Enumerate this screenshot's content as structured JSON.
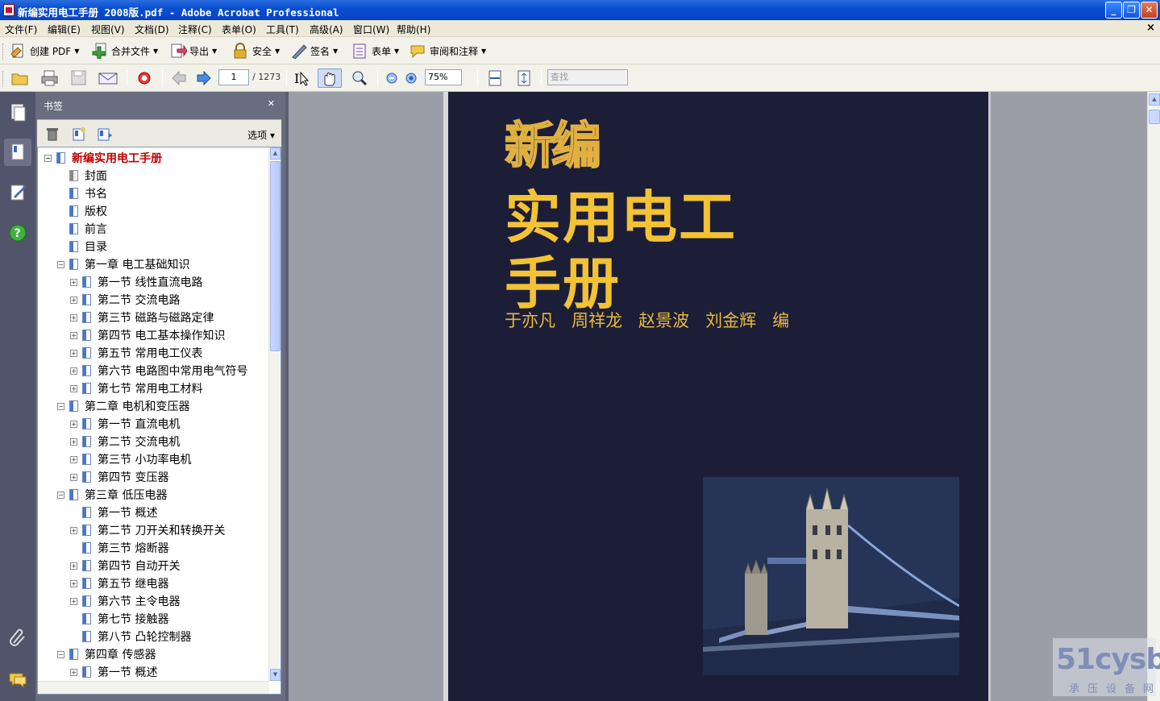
{
  "window": {
    "title": "新编实用电工手册 2008版.pdf - Adobe Acrobat Professional"
  },
  "menu": [
    "文件(F)",
    "编辑(E)",
    "视图(V)",
    "文档(D)",
    "注释(C)",
    "表单(O)",
    "工具(T)",
    "高级(A)",
    "窗口(W)",
    "帮助(H)"
  ],
  "toolbar1": {
    "create_pdf": "创建 PDF",
    "combine": "合并文件",
    "export": "导出",
    "secure": "安全",
    "sign": "签名",
    "forms": "表单",
    "review": "审阅和注释"
  },
  "toolbar2": {
    "page_current": "1",
    "page_total": "/ 1273",
    "zoom": "75%",
    "find_placeholder": "查找"
  },
  "bookmarks": {
    "title": "书签",
    "options": "选项",
    "items": [
      {
        "label": "新编实用电工手册",
        "level": 0,
        "exp": "⊟",
        "root": true
      },
      {
        "label": "封面",
        "level": 1,
        "exp": "",
        "gray": true
      },
      {
        "label": "书名",
        "level": 1,
        "exp": ""
      },
      {
        "label": "版权",
        "level": 1,
        "exp": ""
      },
      {
        "label": "前言",
        "level": 1,
        "exp": ""
      },
      {
        "label": "目录",
        "level": 1,
        "exp": ""
      },
      {
        "label": "第一章  电工基础知识",
        "level": 1,
        "exp": "⊟"
      },
      {
        "label": "第一节  线性直流电路",
        "level": 2,
        "exp": "⊞"
      },
      {
        "label": "第二节  交流电路",
        "level": 2,
        "exp": "⊞"
      },
      {
        "label": "第三节  磁路与磁路定律",
        "level": 2,
        "exp": "⊞"
      },
      {
        "label": "第四节  电工基本操作知识",
        "level": 2,
        "exp": "⊞"
      },
      {
        "label": "第五节  常用电工仪表",
        "level": 2,
        "exp": "⊞"
      },
      {
        "label": "第六节  电路图中常用电气符号",
        "level": 2,
        "exp": "⊞"
      },
      {
        "label": "第七节  常用电工材料",
        "level": 2,
        "exp": "⊞"
      },
      {
        "label": "第二章  电机和变压器",
        "level": 1,
        "exp": "⊟"
      },
      {
        "label": "第一节  直流电机",
        "level": 2,
        "exp": "⊞"
      },
      {
        "label": "第二节  交流电机",
        "level": 2,
        "exp": "⊞"
      },
      {
        "label": "第三节  小功率电机",
        "level": 2,
        "exp": "⊞"
      },
      {
        "label": "第四节  变压器",
        "level": 2,
        "exp": "⊞"
      },
      {
        "label": "第三章   低压电器",
        "level": 1,
        "exp": "⊟"
      },
      {
        "label": "第一节  概述",
        "level": 2,
        "exp": ""
      },
      {
        "label": "第二节  刀开关和转换开关",
        "level": 2,
        "exp": "⊞"
      },
      {
        "label": "第三节  熔断器",
        "level": 2,
        "exp": ""
      },
      {
        "label": "第四节  自动开关",
        "level": 2,
        "exp": "⊞"
      },
      {
        "label": "第五节  继电器",
        "level": 2,
        "exp": "⊞"
      },
      {
        "label": "第六节  主令电器",
        "level": 2,
        "exp": "⊞"
      },
      {
        "label": "第七节  接触器",
        "level": 2,
        "exp": ""
      },
      {
        "label": "第八节  凸轮控制器",
        "level": 2,
        "exp": ""
      },
      {
        "label": "第四章   传感器",
        "level": 1,
        "exp": "⊟"
      },
      {
        "label": "第一节  概述",
        "level": 2,
        "exp": "⊞"
      }
    ]
  },
  "cover": {
    "title_line1": "新编",
    "title_line2": "实用电工",
    "title_line3": "手册",
    "authors": "于亦凡   周祥龙   赵景波   刘金辉   编"
  },
  "watermark": {
    "logo": "51cysb",
    "sub": "承压设备网"
  },
  "colors": {
    "cover_bg": "#1c1e38",
    "cover_gold": "#f3c235",
    "bookmark_root": "#c00000",
    "titlebar": "#0a4fd1"
  }
}
